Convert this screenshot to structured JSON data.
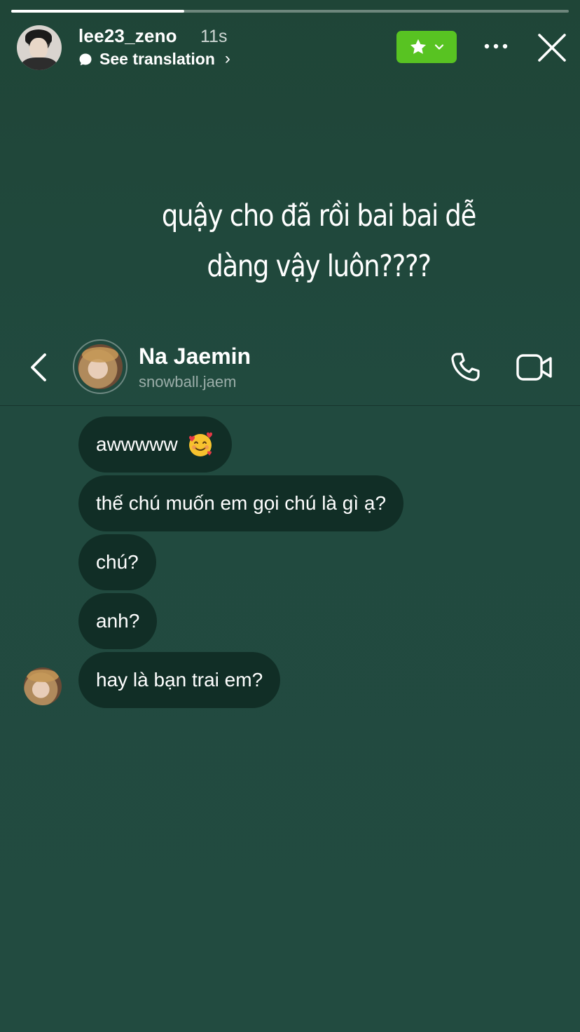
{
  "story": {
    "progress": 0.31,
    "username": "lee23_zeno",
    "time": "11s",
    "translation_label": "See translation",
    "badge_color": "#58c322"
  },
  "caption": {
    "line1": "quậy cho đã rồi bai bai dễ",
    "line2": "dàng vậy luôn????"
  },
  "chat": {
    "name": "Na Jaemin",
    "handle": "snowball.jaem",
    "messages": [
      {
        "text": "awwwww",
        "emoji": "smiling-face-with-hearts"
      },
      {
        "text": "thế chú muốn em gọi chú là gì ạ?"
      },
      {
        "text": "chú?"
      },
      {
        "text": "anh?"
      },
      {
        "text": "hay là bạn trai em?"
      }
    ]
  },
  "colors": {
    "background": "#214a3f",
    "bubble": "#112e26"
  }
}
